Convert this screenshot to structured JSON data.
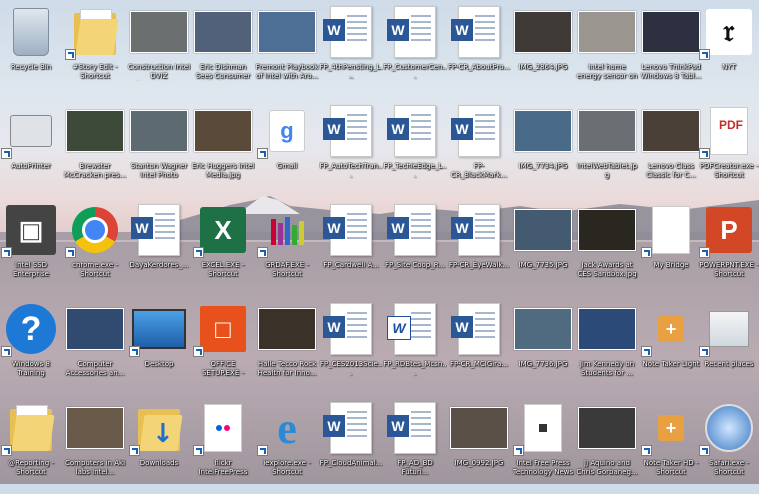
{
  "desktop": {
    "icons": [
      {
        "id": "recycle-bin",
        "label": "Recycle Bin",
        "kind": "recycle",
        "shortcut": false,
        "icon": "recycle-bin-icon"
      },
      {
        "id": "story-edit",
        "label": "#Story Edit - Shortcut",
        "kind": "folder",
        "shortcut": true,
        "icon": "folder-icon"
      },
      {
        "id": "construction-intel",
        "label": "Construction Intel DVIZ Developers...",
        "kind": "photo",
        "color": "#6b6f6f",
        "shortcut": false,
        "icon": "photo-thumbnail"
      },
      {
        "id": "eric-dishman",
        "label": "Eric Dishman Sees Consumer Techno...",
        "kind": "photo",
        "color": "#52617a",
        "shortcut": false,
        "icon": "photo-thumbnail"
      },
      {
        "id": "fremont-playbook",
        "label": "Fremont Playbook of Intel with Aro...",
        "kind": "photo",
        "color": "#4e6f95",
        "shortcut": false,
        "icon": "photo-thumbnail"
      },
      {
        "id": "fp-4thpensting",
        "label": "FP_4thPensting_L...",
        "kind": "word",
        "shortcut": false,
        "icon": "word-doc-icon"
      },
      {
        "id": "fp-customer",
        "label": "FP_CustomerCen...",
        "kind": "word",
        "shortcut": false,
        "icon": "word-doc-icon"
      },
      {
        "id": "fp-cr-aboutpro",
        "label": "FP-CR_AboutPro...",
        "kind": "word",
        "shortcut": false,
        "icon": "word-doc-icon"
      },
      {
        "id": "img-2864",
        "label": "IMG_2864.JPG",
        "kind": "photo",
        "color": "#3f3a36",
        "shortcut": false,
        "icon": "photo-thumbnail"
      },
      {
        "id": "intel-home-energy",
        "label": "Intel home energy sensor on mount...",
        "kind": "photo",
        "color": "#9a968f",
        "shortcut": false,
        "icon": "photo-thumbnail"
      },
      {
        "id": "lenovo-thinkpad",
        "label": "Lenovo ThinkPad Windows 8 Tabl...",
        "kind": "photo",
        "color": "#2d3040",
        "shortcut": false,
        "icon": "photo-thumbnail"
      },
      {
        "id": "nyt",
        "label": "NYT",
        "kind": "nyt",
        "shortcut": true,
        "icon": "nyt-logo-icon"
      },
      {
        "id": "autoprinter",
        "label": "AutoPrinter",
        "kind": "printer",
        "shortcut": true,
        "icon": "printer-icon"
      },
      {
        "id": "brewster",
        "label": "Brewster McCracken pres...",
        "kind": "photo",
        "color": "#3d4a3a",
        "shortcut": false,
        "icon": "photo-thumbnail"
      },
      {
        "id": "stanton-wagner",
        "label": "Stanton Wagner Intel Photo Conte...",
        "kind": "photo",
        "color": "#5d6a72",
        "shortcut": false,
        "icon": "photo-thumbnail"
      },
      {
        "id": "eric-huggers",
        "label": "Eric Huggers Intel Media.jpg",
        "kind": "photo",
        "color": "#5a4a3a",
        "shortcut": false,
        "icon": "photo-thumbnail"
      },
      {
        "id": "gmail",
        "label": "Gmail",
        "kind": "gmail",
        "shortcut": true,
        "icon": "google-icon"
      },
      {
        "id": "fp-autotech",
        "label": "FP_AutoTechTran...",
        "kind": "word",
        "shortcut": false,
        "icon": "word-doc-icon"
      },
      {
        "id": "fp-techedge",
        "label": "FP_TechieEdge_L...",
        "kind": "word",
        "shortcut": false,
        "icon": "word-doc-icon"
      },
      {
        "id": "fp-cr-blackmark",
        "label": "FP-CR_BlackMark...",
        "kind": "word",
        "shortcut": false,
        "icon": "word-doc-icon"
      },
      {
        "id": "img-7734",
        "label": "IMG_7734.JPG",
        "kind": "photo",
        "color": "#4a6a8a",
        "shortcut": false,
        "icon": "photo-thumbnail"
      },
      {
        "id": "intelwebtablet",
        "label": "IntelWebTablet.jpg",
        "kind": "photo",
        "color": "#6a6f73",
        "shortcut": false,
        "icon": "photo-thumbnail"
      },
      {
        "id": "lenovo-classic",
        "label": "Lenovo Class Classic for C...",
        "kind": "photo",
        "color": "#4a4038",
        "shortcut": false,
        "icon": "photo-thumbnail"
      },
      {
        "id": "pdfcreator",
        "label": "PDFCreator.exe - Shortcut",
        "kind": "pdf",
        "shortcut": true,
        "icon": "pdf-icon"
      },
      {
        "id": "intel-ssd",
        "label": "Intel SSD Enterprise",
        "kind": "ssd",
        "shortcut": true,
        "icon": "ssd-icon"
      },
      {
        "id": "chrome",
        "label": "chrome.exe - Shortcut",
        "kind": "chrome",
        "shortcut": true,
        "icon": "chrome-icon"
      },
      {
        "id": "dayakerdores",
        "label": "DayaKerdores_...",
        "kind": "word",
        "shortcut": false,
        "icon": "word-doc-icon"
      },
      {
        "id": "excel",
        "label": "EXCEL.EXE - Shortcut",
        "kind": "excel",
        "shortcut": true,
        "icon": "excel-icon"
      },
      {
        "id": "grdaf",
        "label": "GRDAF.EXE - Shortcut",
        "kind": "grdaf",
        "shortcut": true,
        "icon": "app-icon"
      },
      {
        "id": "fp-cardwell",
        "label": "FP_Cardwell A...",
        "kind": "word",
        "shortcut": false,
        "icon": "word-doc-icon"
      },
      {
        "id": "fp-sitecoop",
        "label": "FP_Site Coop_R...",
        "kind": "word",
        "shortcut": false,
        "icon": "word-doc-icon"
      },
      {
        "id": "fp-cr-eyewalk",
        "label": "FP-CR_EyeWalk...",
        "kind": "word",
        "shortcut": false,
        "icon": "word-doc-icon"
      },
      {
        "id": "img-7735",
        "label": "IMG_7735.JPG",
        "kind": "photo",
        "color": "#445a70",
        "shortcut": false,
        "icon": "photo-thumbnail"
      },
      {
        "id": "jack-awards",
        "label": "Jack Awards at CES Sandbox.jpg",
        "kind": "photo",
        "color": "#2a2620",
        "shortcut": false,
        "icon": "photo-thumbnail"
      },
      {
        "id": "my-bridge",
        "label": "My Bridge",
        "kind": "blank",
        "shortcut": true,
        "icon": "document-icon"
      },
      {
        "id": "powerpnt",
        "label": "POWERPNT.EXE - Shortcut",
        "kind": "ppt",
        "shortcut": true,
        "icon": "powerpoint-icon"
      },
      {
        "id": "windows-training",
        "label": "Windows 8 Training",
        "kind": "help",
        "shortcut": true,
        "icon": "help-icon"
      },
      {
        "id": "computer-accessories",
        "label": "Computer Accessories an...",
        "kind": "photo",
        "color": "#304a70",
        "shortcut": false,
        "icon": "photo-thumbnail"
      },
      {
        "id": "desktop",
        "label": "Desktop",
        "kind": "desktop",
        "shortcut": true,
        "icon": "monitor-icon"
      },
      {
        "id": "office-setup",
        "label": "OFFICE SETUP.EXE - Shortcut",
        "kind": "office",
        "shortcut": true,
        "icon": "office-icon"
      },
      {
        "id": "halle-tecco",
        "label": "Halle Tecco Rock Health for Inno...",
        "kind": "photo",
        "color": "#3a3228",
        "shortcut": false,
        "icon": "photo-thumbnail"
      },
      {
        "id": "fp-ces2013",
        "label": "FP_CES2013Scie...",
        "kind": "word",
        "shortcut": false,
        "icon": "word-doc-icon"
      },
      {
        "id": "fp-rdbtes",
        "label": "FP_RDBtes_Mcsn...",
        "kind": "word-old",
        "shortcut": false,
        "icon": "word-doc-icon"
      },
      {
        "id": "fp-cr-mcigira",
        "label": "FP-CR_MCIGira...",
        "kind": "word",
        "shortcut": false,
        "icon": "word-doc-icon"
      },
      {
        "id": "img-7736",
        "label": "IMG_7736.JPG",
        "kind": "photo",
        "color": "#506a80",
        "shortcut": false,
        "icon": "photo-thumbnail"
      },
      {
        "id": "jim-kennedy",
        "label": "Jim Kennedy on Students for ...",
        "kind": "photo",
        "color": "#2c4a78",
        "shortcut": false,
        "icon": "photo-thumbnail"
      },
      {
        "id": "note-taker-light",
        "label": "Note Taker Light",
        "kind": "notetaker",
        "shortcut": true,
        "icon": "note-icon"
      },
      {
        "id": "recent-places",
        "label": "Recent places",
        "kind": "recent",
        "shortcut": true,
        "icon": "recent-places-icon"
      },
      {
        "id": "reporting",
        "label": "@Reporting - Shortcut",
        "kind": "folder",
        "shortcut": true,
        "icon": "folder-icon"
      },
      {
        "id": "computers-in-aki",
        "label": "Computers in Aki labs Intel...",
        "kind": "photo",
        "color": "#6a5a4a",
        "shortcut": false,
        "icon": "photo-thumbnail"
      },
      {
        "id": "downloads",
        "label": "Downloads",
        "kind": "downloads",
        "shortcut": true,
        "icon": "downloads-folder-icon"
      },
      {
        "id": "flickr",
        "label": "flickr IntelFreePress Photostream",
        "kind": "flickr",
        "shortcut": true,
        "icon": "flickr-icon"
      },
      {
        "id": "iexplore",
        "label": "iexplore.exe - Shortcut",
        "kind": "ie",
        "shortcut": true,
        "icon": "internet-explorer-icon"
      },
      {
        "id": "fp-cloudanimal",
        "label": "FP_CloudAnimal...",
        "kind": "word",
        "shortcut": false,
        "icon": "word-doc-icon"
      },
      {
        "id": "fp-ad-bd",
        "label": "FP_AD_BD Futuri...",
        "kind": "word",
        "shortcut": false,
        "icon": "word-doc-icon"
      },
      {
        "id": "img-0992",
        "label": "IMG_0992.JPG",
        "kind": "photo",
        "color": "#5a5048",
        "shortcut": false,
        "icon": "photo-thumbnail"
      },
      {
        "id": "intel-free-press",
        "label": "Intel Free Press Technology News",
        "kind": "ifp",
        "shortcut": true,
        "icon": "web-page-icon"
      },
      {
        "id": "jj-aquino",
        "label": "JJ Aquino and Chris Gorbaneg...",
        "kind": "photo",
        "color": "#3a3a3a",
        "shortcut": false,
        "icon": "photo-thumbnail"
      },
      {
        "id": "note-taker-hd",
        "label": "Note Taker HD - Shortcut",
        "kind": "notetaker",
        "shortcut": true,
        "icon": "note-icon"
      },
      {
        "id": "safari",
        "label": "Safari.exe - Shortcut",
        "kind": "safari",
        "shortcut": true,
        "icon": "safari-icon"
      }
    ]
  }
}
